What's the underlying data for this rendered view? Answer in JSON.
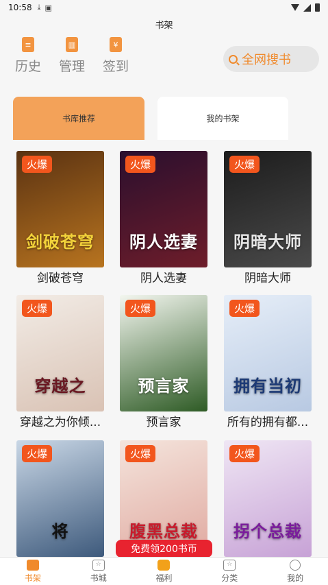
{
  "status_bar": {
    "time": "10:58"
  },
  "header": {
    "title": "书架"
  },
  "quick_actions": [
    {
      "label": "历史",
      "icon": "document-icon",
      "glyph": "≡"
    },
    {
      "label": "管理",
      "icon": "trash-icon",
      "glyph": "▥"
    },
    {
      "label": "签到",
      "icon": "checkin-icon",
      "glyph": "¥"
    }
  ],
  "search": {
    "label": "全网搜书"
  },
  "tabs": {
    "recommend": "书库推荐",
    "shelf": "我的书架"
  },
  "hot_label": "火爆",
  "books": [
    {
      "title": "剑破苍穹",
      "cover_text": "剑破苍穹",
      "colors": [
        "#5a3212",
        "#b8741f"
      ],
      "text_color": "#f2d23a"
    },
    {
      "title": "阴人选妻",
      "cover_text": "阴人选妻",
      "colors": [
        "#2a0f2e",
        "#6e1d2a"
      ],
      "text_color": "#ffffff"
    },
    {
      "title": "阴暗大师",
      "cover_text": "阴暗大师",
      "colors": [
        "#1c1c1c",
        "#4a4a4a"
      ],
      "text_color": "#e8e8e8"
    },
    {
      "title": "穿越之为你倾...",
      "cover_text": "穿越之",
      "colors": [
        "#f2ece6",
        "#d9c2b4"
      ],
      "text_color": "#6a1822"
    },
    {
      "title": "预言家",
      "cover_text": "预言家",
      "colors": [
        "#f3f6ef",
        "#2e5b25"
      ],
      "text_color": "#ffffff"
    },
    {
      "title": "所有的拥有都...",
      "cover_text": "拥有当初",
      "colors": [
        "#e6eef8",
        "#b8c9e2"
      ],
      "text_color": "#1d3a75"
    },
    {
      "title": "",
      "cover_text": "将",
      "colors": [
        "#c9d7e6",
        "#3e5a7c"
      ],
      "text_color": "#111111"
    },
    {
      "title": "",
      "cover_text": "腹黑总裁",
      "colors": [
        "#f4e4dc",
        "#e0a9a0"
      ],
      "text_color": "#c81b2c"
    },
    {
      "title": "",
      "cover_text": "拐个总裁",
      "colors": [
        "#efe6f4",
        "#c7a2d6"
      ],
      "text_color": "#7a1c9c"
    }
  ],
  "promo": {
    "label": "免费领200书币"
  },
  "nav": [
    {
      "label": "书架",
      "icon": "bookshelf-icon",
      "active": true
    },
    {
      "label": "书城",
      "icon": "store-icon",
      "active": false
    },
    {
      "label": "福利",
      "icon": "welfare-icon",
      "active": false
    },
    {
      "label": "分类",
      "icon": "category-icon",
      "active": false
    },
    {
      "label": "我的",
      "icon": "profile-icon",
      "active": false
    }
  ],
  "colors": {
    "accent": "#f08a2c",
    "hot": "#f2561d",
    "promo": "#e8232f"
  }
}
